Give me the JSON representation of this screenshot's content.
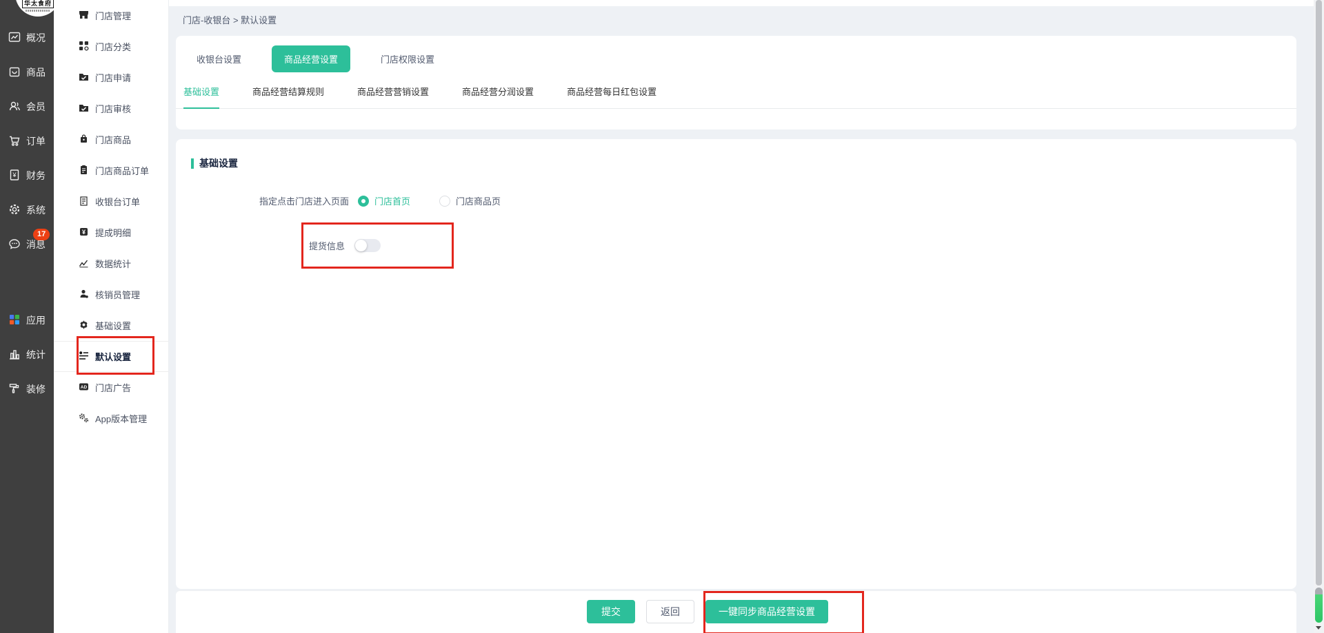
{
  "colors": {
    "accent": "#2dbf9a",
    "annotation_red": "#e3261d",
    "badge_red": "#ed4014",
    "sidebar_dark": "#3f3f3f"
  },
  "logo": {
    "title": "华太食府"
  },
  "primary_nav": {
    "items": [
      {
        "label": "概况"
      },
      {
        "label": "商品"
      },
      {
        "label": "会员"
      },
      {
        "label": "订单"
      },
      {
        "label": "财务"
      },
      {
        "label": "系统"
      },
      {
        "label": "消息",
        "badge": "17"
      },
      {
        "label": "应用"
      },
      {
        "label": "统计"
      },
      {
        "label": "装修"
      }
    ]
  },
  "secondary_nav": {
    "items": [
      {
        "label": "门店管理"
      },
      {
        "label": "门店分类"
      },
      {
        "label": "门店申请"
      },
      {
        "label": "门店审核"
      },
      {
        "label": "门店商品"
      },
      {
        "label": "门店商品订单"
      },
      {
        "label": "收银台订单"
      },
      {
        "label": "提成明细"
      },
      {
        "label": "数据统计"
      },
      {
        "label": "核销员管理"
      },
      {
        "label": "基础设置"
      },
      {
        "label": "默认设置",
        "active": true
      },
      {
        "label": "门店广告"
      },
      {
        "label": "App版本管理"
      }
    ]
  },
  "breadcrumb": {
    "text": "门店-收银台 > 默认设置"
  },
  "tabs": {
    "items": [
      {
        "label": "收银台设置"
      },
      {
        "label": "商品经营设置",
        "active": true
      },
      {
        "label": "门店权限设置"
      }
    ]
  },
  "subtabs": {
    "items": [
      {
        "label": "基础设置",
        "active": true
      },
      {
        "label": "商品经营结算规则"
      },
      {
        "label": "商品经营营销设置"
      },
      {
        "label": "商品经营分润设置"
      },
      {
        "label": "商品经营每日红包设置"
      }
    ]
  },
  "content": {
    "section_title": "基础设置",
    "entry_page": {
      "label": "指定点击门店进入页面",
      "options": [
        {
          "label": "门店首页",
          "selected": true
        },
        {
          "label": "门店商品页",
          "selected": false
        }
      ]
    },
    "pickup": {
      "label": "提货信息",
      "enabled": false
    }
  },
  "footer": {
    "submit": "提交",
    "back": "返回",
    "sync": "一键同步商品经营设置"
  }
}
